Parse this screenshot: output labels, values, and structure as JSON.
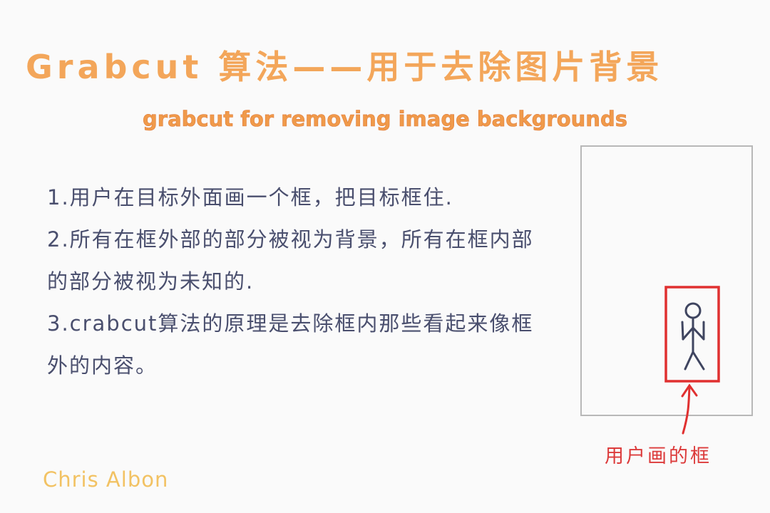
{
  "title": "Grabcut 算法——用于去除图片背景",
  "subtitle": "grabcut for removing image backgrounds",
  "steps": [
    "1.用户在目标外面画一个框，把目标框住.",
    "2.所有在框外部的部分被视为背景，所有在框内部的部分被视为未知的.",
    "3.crabcut算法的原理是去除框内那些看起来像框外的内容。"
  ],
  "diagram": {
    "caption": "用户画的框",
    "colors": {
      "outer_box": "#b8b8b8",
      "user_box": "#e03030",
      "arrow": "#e03030",
      "figure": "#3f4560"
    }
  },
  "author": "Chris Albon"
}
